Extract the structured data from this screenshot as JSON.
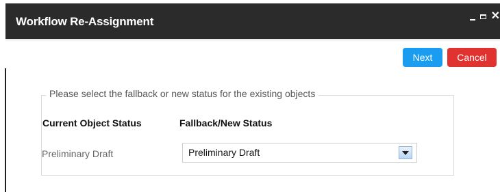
{
  "dialog": {
    "title": "Workflow Re-Assignment"
  },
  "toolbar": {
    "next_label": "Next",
    "cancel_label": "Cancel",
    "next_color": "#1a9cf0",
    "cancel_color": "#e0322f"
  },
  "form": {
    "legend": "Please select the fallback or new status for the existing objects",
    "col_current": "Current Object Status",
    "col_fallback": "Fallback/New Status",
    "rows": [
      {
        "current_status": "Preliminary Draft",
        "fallback_status": "Preliminary Draft"
      }
    ]
  },
  "icons": {
    "minimize": "minimize-icon",
    "maximize": "maximize-icon",
    "close": "close-icon",
    "dropdown": "chevron-down-icon"
  }
}
